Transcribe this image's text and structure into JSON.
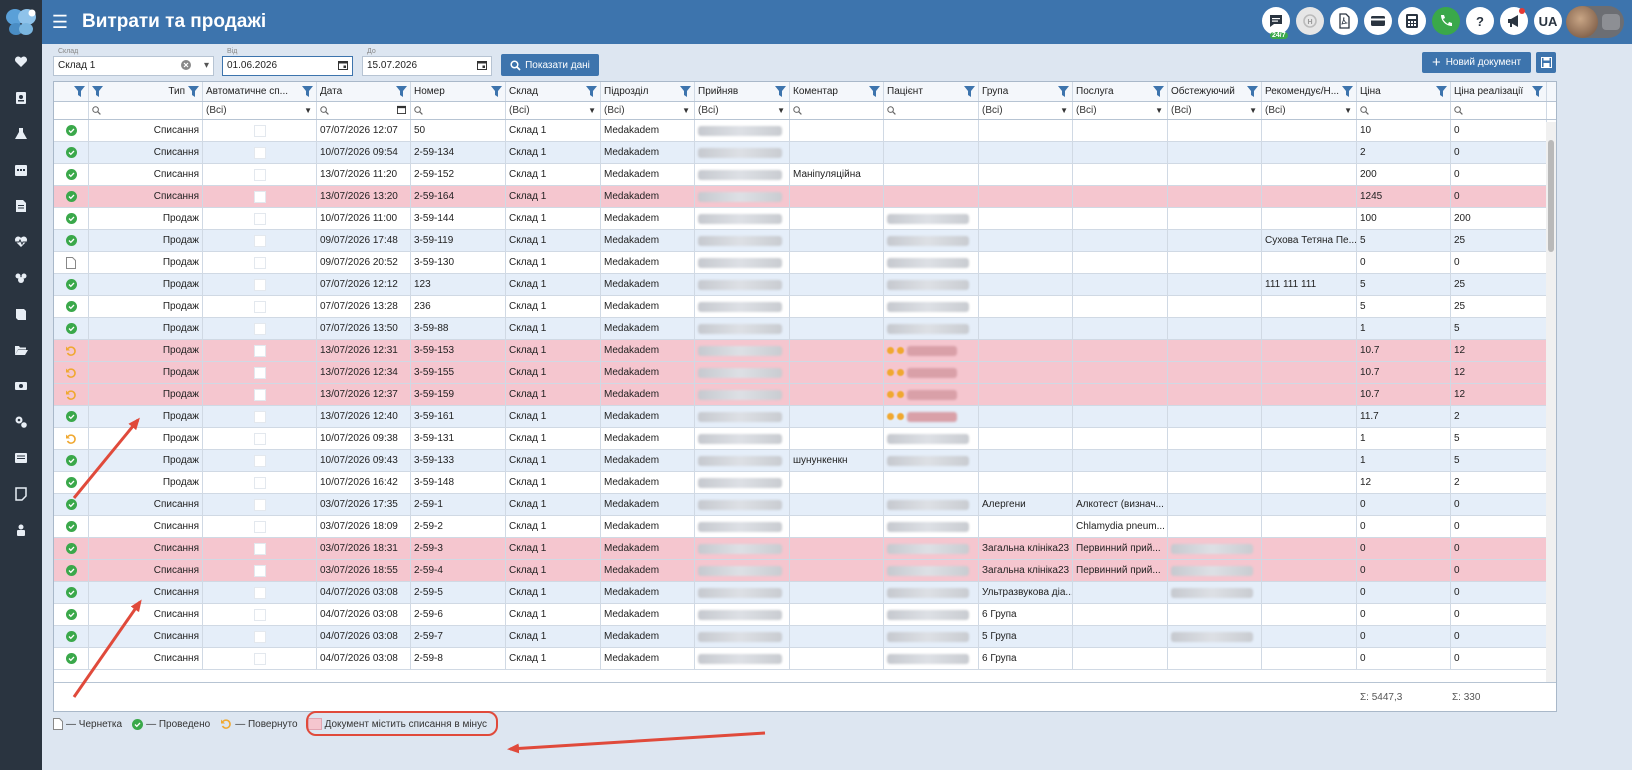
{
  "app": {
    "title": "Витрати та продажі",
    "lang": "UA",
    "support_badge": "24/7"
  },
  "sidebar_icons": [
    "heart-icon",
    "id-card-icon",
    "flask-icon",
    "calendar-icon",
    "document-icon",
    "heartbeat-icon",
    "users-icon",
    "book-icon",
    "folder-open-icon",
    "money-icon",
    "gears-icon",
    "list-icon",
    "note-icon",
    "user-lock-icon"
  ],
  "header_icons": [
    "chat-icon",
    "h-service-icon",
    "pdf-icon",
    "card-icon",
    "calculator-icon",
    "phone-icon",
    "help-icon",
    "megaphone-icon"
  ],
  "filters": {
    "warehouse": {
      "label": "Склад",
      "value": "Склад 1"
    },
    "date_from": {
      "label": "Від",
      "value": "01.06.2026"
    },
    "date_to": {
      "label": "До",
      "value": "15.07.2026"
    },
    "show_button": "Показати дані",
    "new_doc_button": "Новий документ"
  },
  "columns": [
    "",
    "Тип",
    "Автоматичне сп...",
    "Дата",
    "Номер",
    "Склад",
    "Підрозділ",
    "Прийняв",
    "Коментар",
    "Пацієнт",
    "Група",
    "Послуга",
    "Обстежуючий",
    "Рекомендує/Н...",
    "Ціна",
    "Ціна реалізації"
  ],
  "filter_row": [
    "",
    "",
    "(Всі)",
    "",
    "",
    "(Всі)",
    "(Всі)",
    "(Всі)",
    "",
    "",
    "(Всі)",
    "(Всі)",
    "(Всі)",
    "(Всі)",
    "",
    ""
  ],
  "rows": [
    {
      "status": "ok",
      "type": "Списання",
      "date": "07/07/2026 12:07",
      "num": "50",
      "wh": "Склад 1",
      "dept": "Medakadem",
      "comment": "",
      "patient": "",
      "group": "",
      "service": "",
      "examiner": "",
      "recommend": "",
      "price": "10",
      "sale": "0",
      "bg": "white",
      "acc": true
    },
    {
      "status": "ok",
      "type": "Списання",
      "date": "10/07/2026 09:54",
      "num": "2-59-134",
      "wh": "Склад 1",
      "dept": "Medakadem",
      "comment": "",
      "patient": "",
      "group": "",
      "service": "",
      "examiner": "",
      "recommend": "",
      "price": "2",
      "sale": "0",
      "bg": "alt",
      "acc": true
    },
    {
      "status": "ok",
      "type": "Списання",
      "date": "13/07/2026 11:20",
      "num": "2-59-152",
      "wh": "Склад 1",
      "dept": "Medakadem",
      "comment": "Маніпуляційна",
      "patient": "",
      "group": "",
      "service": "",
      "examiner": "",
      "recommend": "",
      "price": "200",
      "sale": "0",
      "bg": "white",
      "acc": true
    },
    {
      "status": "ok",
      "type": "Списання",
      "date": "13/07/2026 13:20",
      "num": "2-59-164",
      "wh": "Склад 1",
      "dept": "Medakadem",
      "comment": "",
      "patient": "",
      "group": "",
      "service": "",
      "examiner": "",
      "recommend": "",
      "price": "1245",
      "sale": "0",
      "bg": "red",
      "acc": true
    },
    {
      "status": "ok",
      "type": "Продаж",
      "date": "10/07/2026 11:00",
      "num": "3-59-144",
      "wh": "Склад 1",
      "dept": "Medakadem",
      "comment": "",
      "patient": "blur",
      "group": "",
      "service": "",
      "examiner": "",
      "recommend": "",
      "price": "100",
      "sale": "200",
      "bg": "white",
      "acc": true
    },
    {
      "status": "ok",
      "type": "Продаж",
      "date": "09/07/2026 17:48",
      "num": "3-59-119",
      "wh": "Склад 1",
      "dept": "Medakadem",
      "comment": "",
      "patient": "blur",
      "group": "",
      "service": "",
      "examiner": "",
      "recommend": "Сухова Тетяна Пе...",
      "price": "5",
      "sale": "25",
      "bg": "alt",
      "acc": true
    },
    {
      "status": "draft",
      "type": "Продаж",
      "date": "09/07/2026 20:52",
      "num": "3-59-130",
      "wh": "Склад 1",
      "dept": "Medakadem",
      "comment": "",
      "patient": "blur",
      "group": "",
      "service": "",
      "examiner": "",
      "recommend": "",
      "price": "0",
      "sale": "0",
      "bg": "white",
      "acc": false
    },
    {
      "status": "ok",
      "type": "Продаж",
      "date": "07/07/2026 12:12",
      "num": "123",
      "wh": "Склад 1",
      "dept": "Medakadem",
      "comment": "",
      "patient": "blur",
      "group": "",
      "service": "",
      "examiner": "",
      "recommend": "111 111 111",
      "price": "5",
      "sale": "25",
      "bg": "alt",
      "acc": true
    },
    {
      "status": "ok",
      "type": "Продаж",
      "date": "07/07/2026 13:28",
      "num": "236",
      "wh": "Склад 1",
      "dept": "Medakadem",
      "comment": "",
      "patient": "blur",
      "group": "",
      "service": "",
      "examiner": "",
      "recommend": "",
      "price": "5",
      "sale": "25",
      "bg": "white",
      "acc": true
    },
    {
      "status": "ok",
      "type": "Продаж",
      "date": "07/07/2026 13:50",
      "num": "3-59-88",
      "wh": "Склад 1",
      "dept": "Medakadem",
      "comment": "",
      "patient": "blur",
      "group": "",
      "service": "",
      "examiner": "",
      "recommend": "",
      "price": "1",
      "sale": "5",
      "bg": "alt",
      "acc": true
    },
    {
      "status": "return",
      "type": "Продаж",
      "date": "13/07/2026 12:31",
      "num": "3-59-153",
      "wh": "Склад 1",
      "dept": "Medakadem",
      "comment": "",
      "patient": "dots",
      "group": "",
      "service": "",
      "examiner": "",
      "recommend": "",
      "price": "10.7",
      "sale": "12",
      "bg": "red",
      "acc": true
    },
    {
      "status": "return",
      "type": "Продаж",
      "date": "13/07/2026 12:34",
      "num": "3-59-155",
      "wh": "Склад 1",
      "dept": "Medakadem",
      "comment": "",
      "patient": "dots",
      "group": "",
      "service": "",
      "examiner": "",
      "recommend": "",
      "price": "10.7",
      "sale": "12",
      "bg": "red",
      "acc": true
    },
    {
      "status": "return",
      "type": "Продаж",
      "date": "13/07/2026 12:37",
      "num": "3-59-159",
      "wh": "Склад 1",
      "dept": "Medakadem",
      "comment": "",
      "patient": "dots",
      "group": "",
      "service": "",
      "examiner": "",
      "recommend": "",
      "price": "10.7",
      "sale": "12",
      "bg": "red",
      "acc": true
    },
    {
      "status": "ok",
      "type": "Продаж",
      "date": "13/07/2026 12:40",
      "num": "3-59-161",
      "wh": "Склад 1",
      "dept": "Medakadem",
      "comment": "",
      "patient": "dots",
      "group": "",
      "service": "",
      "examiner": "",
      "recommend": "",
      "price": "11.7",
      "sale": "2",
      "bg": "alt",
      "acc": true
    },
    {
      "status": "return",
      "type": "Продаж",
      "date": "10/07/2026 09:38",
      "num": "3-59-131",
      "wh": "Склад 1",
      "dept": "Medakadem",
      "comment": "",
      "patient": "blur",
      "group": "",
      "service": "",
      "examiner": "",
      "recommend": "",
      "price": "1",
      "sale": "5",
      "bg": "white",
      "acc": true
    },
    {
      "status": "ok",
      "type": "Продаж",
      "date": "10/07/2026 09:43",
      "num": "3-59-133",
      "wh": "Склад 1",
      "dept": "Medakadem",
      "comment": "шунункенкн",
      "patient": "blur",
      "group": "",
      "service": "",
      "examiner": "",
      "recommend": "",
      "price": "1",
      "sale": "5",
      "bg": "alt",
      "acc": true
    },
    {
      "status": "ok",
      "type": "Продаж",
      "date": "10/07/2026 16:42",
      "num": "3-59-148",
      "wh": "Склад 1",
      "dept": "Medakadem",
      "comment": "",
      "patient": "",
      "group": "",
      "service": "",
      "examiner": "",
      "recommend": "",
      "price": "12",
      "sale": "2",
      "bg": "white",
      "acc": true
    },
    {
      "status": "ok",
      "type": "Списання",
      "date": "03/07/2026 17:35",
      "num": "2-59-1",
      "wh": "Склад 1",
      "dept": "Medakadem",
      "comment": "",
      "patient": "blur",
      "group": "Алергени",
      "service": "Алкотест (визнач...",
      "examiner": "",
      "recommend": "",
      "price": "0",
      "sale": "0",
      "bg": "alt",
      "acc": true
    },
    {
      "status": "ok",
      "type": "Списання",
      "date": "03/07/2026 18:09",
      "num": "2-59-2",
      "wh": "Склад 1",
      "dept": "Medakadem",
      "comment": "",
      "patient": "blur",
      "group": "",
      "service": "Chlamydia pneum...",
      "examiner": "",
      "recommend": "",
      "price": "0",
      "sale": "0",
      "bg": "white",
      "acc": true
    },
    {
      "status": "ok",
      "type": "Списання",
      "date": "03/07/2026 18:31",
      "num": "2-59-3",
      "wh": "Склад 1",
      "dept": "Medakadem",
      "comment": "",
      "patient": "blur",
      "group": "Загальна клініка23",
      "service": "Первинний прий...",
      "examiner": "blur",
      "recommend": "",
      "price": "0",
      "sale": "0",
      "bg": "red",
      "acc": true
    },
    {
      "status": "ok",
      "type": "Списання",
      "date": "03/07/2026 18:55",
      "num": "2-59-4",
      "wh": "Склад 1",
      "dept": "Medakadem",
      "comment": "",
      "patient": "blur",
      "group": "Загальна клініка23",
      "service": "Первинний прий...",
      "examiner": "blur",
      "recommend": "",
      "price": "0",
      "sale": "0",
      "bg": "red",
      "acc": true
    },
    {
      "status": "ok",
      "type": "Списання",
      "date": "04/07/2026 03:08",
      "num": "2-59-5",
      "wh": "Склад 1",
      "dept": "Medakadem",
      "comment": "",
      "patient": "blur",
      "group": "Ультразвукова діа...",
      "service": "",
      "examiner": "blur",
      "recommend": "",
      "price": "0",
      "sale": "0",
      "bg": "alt",
      "acc": true
    },
    {
      "status": "ok",
      "type": "Списання",
      "date": "04/07/2026 03:08",
      "num": "2-59-6",
      "wh": "Склад 1",
      "dept": "Medakadem",
      "comment": "",
      "patient": "blur",
      "group": "6 Група",
      "service": "",
      "examiner": "",
      "recommend": "",
      "price": "0",
      "sale": "0",
      "bg": "white",
      "acc": true
    },
    {
      "status": "ok",
      "type": "Списання",
      "date": "04/07/2026 03:08",
      "num": "2-59-7",
      "wh": "Склад 1",
      "dept": "Medakadem",
      "comment": "",
      "patient": "blur",
      "group": "5 Група",
      "service": "",
      "examiner": "blur",
      "recommend": "",
      "price": "0",
      "sale": "0",
      "bg": "alt",
      "acc": true
    },
    {
      "status": "ok",
      "type": "Списання",
      "date": "04/07/2026 03:08",
      "num": "2-59-8",
      "wh": "Склад 1",
      "dept": "Medakadem",
      "comment": "",
      "patient": "blur",
      "group": "6 Група",
      "service": "",
      "examiner": "",
      "recommend": "",
      "price": "0",
      "sale": "0",
      "bg": "white",
      "acc": true
    }
  ],
  "totals": {
    "price": "Σ: 5447,3",
    "sale": "Σ: 330"
  },
  "legend": {
    "draft": "— Чернетка",
    "done": "— Проведено",
    "returned": "— Повернуто",
    "minus": "Документ містить списання в мінус"
  },
  "colors": {
    "header": "#3d74ad",
    "sidebar": "#2a3440",
    "row_alt": "#e5eef9",
    "row_red": "#f5c6cf",
    "ok": "#3aa84a",
    "returned": "#f0a830",
    "annotation": "#e04a3b"
  }
}
